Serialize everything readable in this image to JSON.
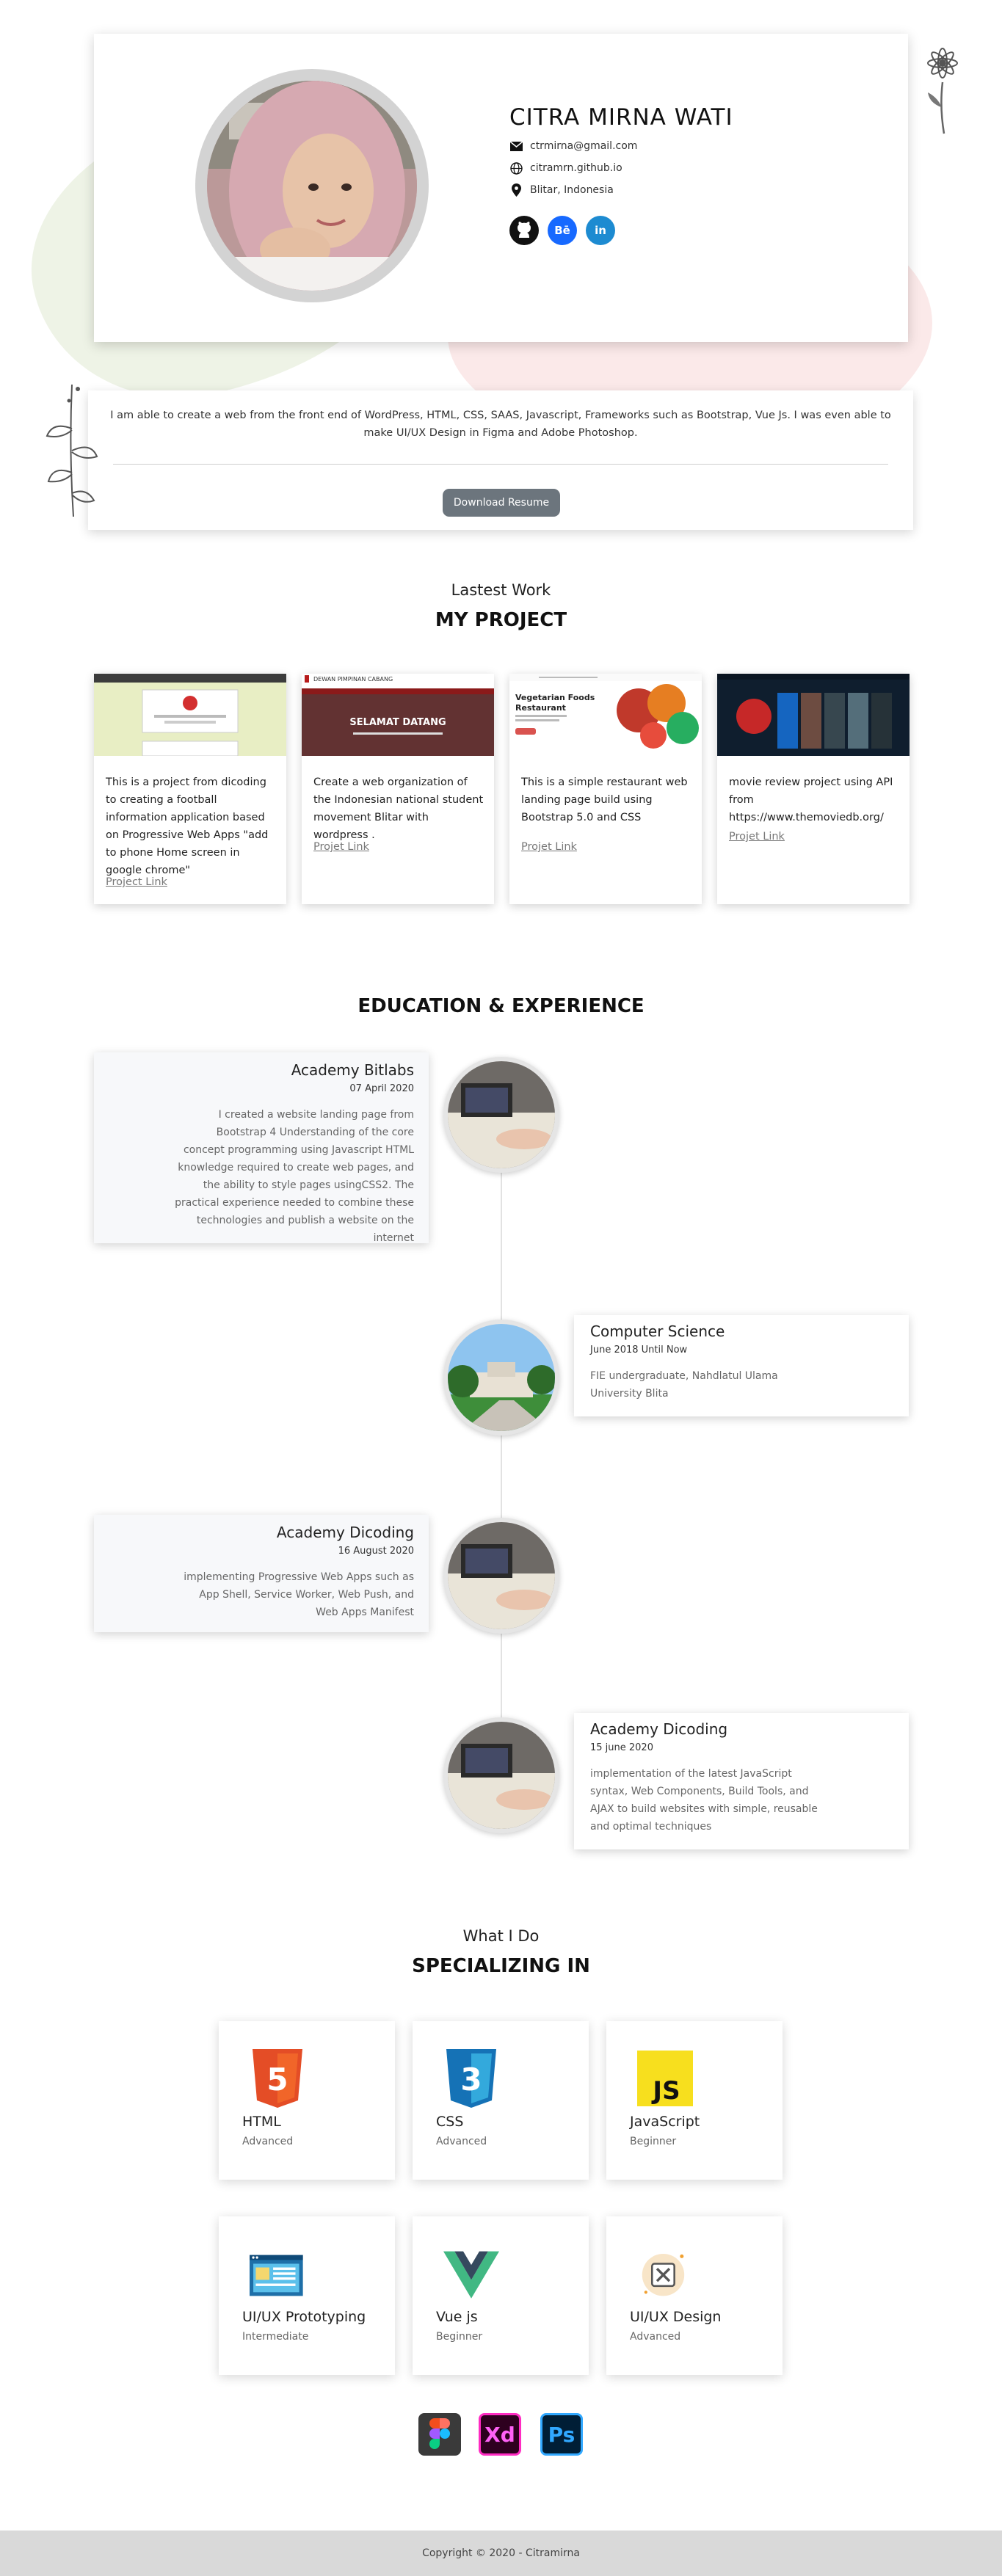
{
  "profile": {
    "name": "CITRA MIRNA WATI",
    "email": "ctrmirna@gmail.com",
    "website": "citramrn.github.io",
    "location": "Blitar, Indonesia",
    "socials": [
      {
        "icon": "github-icon",
        "label": "",
        "color": "#111111"
      },
      {
        "icon": "behance-icon",
        "label": "Bē",
        "color": "#1769ff"
      },
      {
        "icon": "linkedin-icon",
        "label": "in",
        "color": "#1d8bd1"
      }
    ]
  },
  "about": {
    "text": "I am able to create a web from the front end of WordPress, HTML, CSS, SAAS, Javascript, Frameworks such as Bootstrap, Vue Js. I was even able to make UI/UX Design in Figma and Adobe Photoshop.",
    "resume_button": "Download Resume"
  },
  "projects_section": {
    "subtitle": "Lastest Work",
    "title": "MY PROJECT",
    "items": [
      {
        "description": "This is a project from dicoding to creating a football information application based on Progressive Web Apps \"add to phone Home screen in google chrome\"",
        "link": "Project Link"
      },
      {
        "description": "Create a web organization of the Indonesian national student movement Blitar with wordpress .",
        "link": "Projet Link",
        "thumb_banner": "SELAMAT DATANG",
        "thumb_header": "DEWAN PIMPINAN CABANG"
      },
      {
        "description": "This is a simple restaurant web landing page build using Bootstrap 5.0 and CSS",
        "link": "Projet Link",
        "thumb_heading": "Vegetarian Foods Restaurant"
      },
      {
        "description": "movie review project using API from https://www.themoviedb.org/",
        "link": "Projet Link"
      }
    ]
  },
  "timeline_section": {
    "title": "EDUCATION & EXPERIENCE",
    "items": [
      {
        "title": "Academy Bitlabs",
        "date": "07 April 2020",
        "body": "I created a website landing page from Bootstrap 4 Understanding of the core concept programming using Javascript HTML knowledge required to create web pages, and the ability to style pages usingCSS2. The practical experience needed to combine these technologies and publish a website on the internet"
      },
      {
        "title": "Computer Science",
        "date": "June 2018 Until Now",
        "body": "FIE undergraduate, Nahdlatul Ulama University Blita"
      },
      {
        "title": "Academy Dicoding",
        "date": "16 August 2020",
        "body": "implementing Progressive Web Apps such as App Shell, Service Worker, Web Push, and Web Apps Manifest"
      },
      {
        "title": "Academy Dicoding",
        "date": "15 june 2020",
        "body": "implementation of the latest JavaScript syntax, Web Components, Build Tools, and AJAX to build websites with simple, reusable and optimal techniques"
      }
    ]
  },
  "skills_section": {
    "subtitle": "What I Do",
    "title": "SPECIALIZING IN",
    "items": [
      {
        "name": "HTML",
        "level": "Advanced",
        "icon": "html5-icon",
        "glyph": "5"
      },
      {
        "name": "CSS",
        "level": "Advanced",
        "icon": "css3-icon",
        "glyph": "3"
      },
      {
        "name": "JavaScript",
        "level": "Beginner",
        "icon": "javascript-icon",
        "glyph": "JS"
      },
      {
        "name": "UI/UX Prototyping",
        "level": "Intermediate",
        "icon": "prototyping-icon",
        "glyph": ""
      },
      {
        "name": "Vue js",
        "level": "Beginner",
        "icon": "vuejs-icon",
        "glyph": ""
      },
      {
        "name": "UI/UX Design",
        "level": "Advanced",
        "icon": "uiux-design-icon",
        "glyph": ""
      }
    ],
    "tools": [
      {
        "icon": "figma-icon",
        "label": ""
      },
      {
        "icon": "adobe-xd-icon",
        "label": "Xd"
      },
      {
        "icon": "photoshop-icon",
        "label": "Ps"
      }
    ]
  },
  "footer": {
    "text": "Copyright © 2020 - Citramirna"
  },
  "colors": {
    "button": "#6c757d",
    "html": "#e44d26",
    "css": "#1572b6",
    "js": "#f7df1e",
    "footer": "#d9d9d9"
  }
}
